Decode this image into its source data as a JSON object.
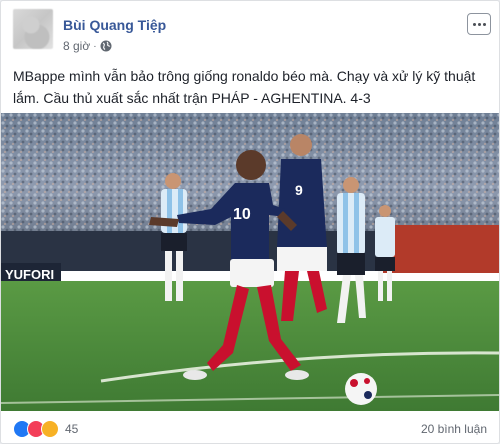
{
  "post": {
    "author": "Bùi Quang Tiệp",
    "time": "8 giờ",
    "separator": "·",
    "privacy_icon": "globe-icon",
    "text": "MBappe mình vẫn bảo trông giống ronaldo béo mà. Chạy và xử lý kỹ thuật lắm. Cầu thủ xuất sắc nhất trận PHÁP - AGHENTINA. 4-3",
    "more_icon": "more-options-icon"
  },
  "photo": {
    "player_number_front": "10",
    "player_number_back": "9",
    "banner_text": "YUFORI"
  },
  "footer": {
    "reaction_icons": [
      "like-icon",
      "love-icon",
      "haha-icon"
    ],
    "reaction_count": "45",
    "comments": "20 bình luận"
  },
  "colors": {
    "author": "#385898",
    "france_jersey": "#1b2a5c",
    "argentina_stripe": "#8fc2e8",
    "pitch": "#4c8a3c"
  }
}
